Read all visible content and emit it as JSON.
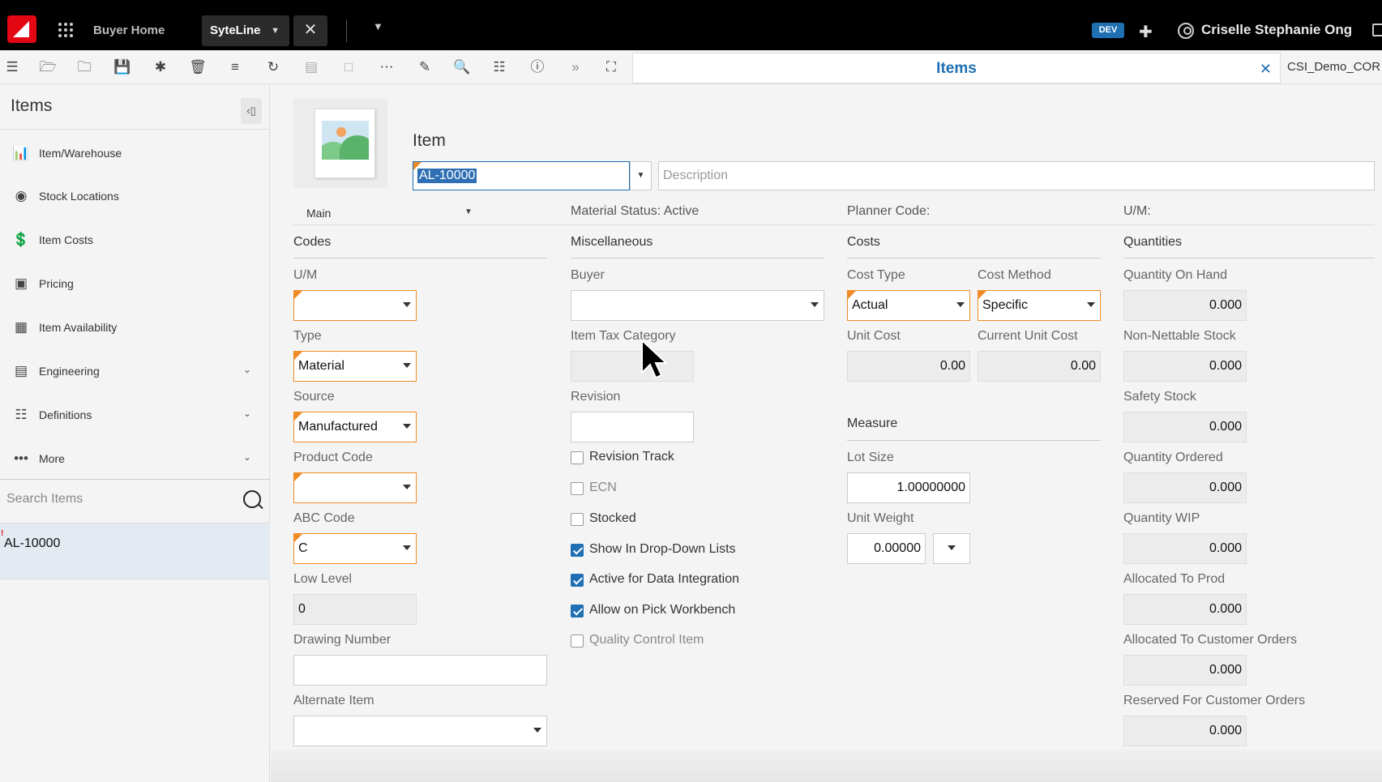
{
  "topbar": {
    "apps_icon": "grid-dots-icon",
    "tabs": [
      {
        "label": "Buyer Home"
      },
      {
        "label": "SyteLine"
      }
    ],
    "env_badge": "DEV",
    "user_name": "Criselle Stephanie Ong"
  },
  "toolbar": {
    "form_title": "Items",
    "config": "CSI_Demo_COR"
  },
  "sidebar": {
    "title": "Items",
    "items": [
      {
        "label": "Item/Warehouse",
        "icon": "warehouse-icon"
      },
      {
        "label": "Stock Locations",
        "icon": "location-pin-icon"
      },
      {
        "label": "Item Costs",
        "icon": "cost-icon"
      },
      {
        "label": "Pricing",
        "icon": "pricing-icon"
      },
      {
        "label": "Item Availability",
        "icon": "availability-icon"
      },
      {
        "label": "Engineering",
        "icon": "engineering-icon"
      },
      {
        "label": "Definitions",
        "icon": "definitions-icon"
      },
      {
        "label": "More",
        "icon": "more-dots-icon"
      }
    ],
    "search_placeholder": "Search Items",
    "results": [
      {
        "label": "AL-10000"
      }
    ]
  },
  "header": {
    "item_label": "Item",
    "item_value": "AL-10000",
    "description_placeholder": "Description"
  },
  "info": {
    "tab_select": "Main",
    "material_status": "Material Status: Active",
    "planner_code": "Planner Code:",
    "um": "U/M:"
  },
  "codes": {
    "title": "Codes",
    "um_label": "U/M",
    "um_value": "",
    "type_label": "Type",
    "type_value": "Material",
    "source_label": "Source",
    "source_value": "Manufactured",
    "product_code_label": "Product Code",
    "product_code_value": "",
    "abc_code_label": "ABC Code",
    "abc_code_value": "C",
    "low_level_label": "Low Level",
    "low_level_value": "0",
    "drawing_number_label": "Drawing Number",
    "drawing_number_value": "",
    "alternate_item_label": "Alternate Item",
    "alternate_item_value": ""
  },
  "misc": {
    "title": "Miscellaneous",
    "buyer_label": "Buyer",
    "buyer_value": "",
    "tax_label": "Item Tax Category",
    "tax_value": "",
    "revision_label": "Revision",
    "revision_value": "",
    "checkboxes": [
      {
        "label": "Revision Track",
        "checked": false
      },
      {
        "label": "ECN",
        "checked": false
      },
      {
        "label": "Stocked",
        "checked": false
      },
      {
        "label": "Show In Drop-Down Lists",
        "checked": true
      },
      {
        "label": "Active for Data Integration",
        "checked": true
      },
      {
        "label": "Allow on Pick Workbench",
        "checked": true
      },
      {
        "label": "Quality Control Item",
        "checked": false
      }
    ]
  },
  "costs": {
    "title": "Costs",
    "cost_type_label": "Cost Type",
    "cost_type_value": "Actual",
    "cost_method_label": "Cost Method",
    "cost_method_value": "Specific",
    "unit_cost_label": "Unit Cost",
    "unit_cost_value": "0.00",
    "current_unit_cost_label": "Current Unit Cost",
    "current_unit_cost_value": "0.00"
  },
  "measure": {
    "title": "Measure",
    "lot_size_label": "Lot Size",
    "lot_size_value": "1.00000000",
    "unit_weight_label": "Unit Weight",
    "unit_weight_value": "0.00000"
  },
  "quantities": {
    "title": "Quantities",
    "fields": [
      {
        "label": "Quantity On Hand",
        "value": "0.000"
      },
      {
        "label": "Non-Nettable Stock",
        "value": "0.000"
      },
      {
        "label": "Safety Stock",
        "value": "0.000"
      },
      {
        "label": "Quantity Ordered",
        "value": "0.000"
      },
      {
        "label": "Quantity WIP",
        "value": "0.000"
      },
      {
        "label": "Allocated To Prod",
        "value": "0.000"
      },
      {
        "label": "Allocated To Customer Orders",
        "value": "0.000"
      },
      {
        "label": "Reserved For Customer Orders",
        "value": "0.000"
      }
    ]
  },
  "colors": {
    "accent": "#1f6fb3",
    "required": "#f08a24",
    "brand": "#e30613"
  }
}
